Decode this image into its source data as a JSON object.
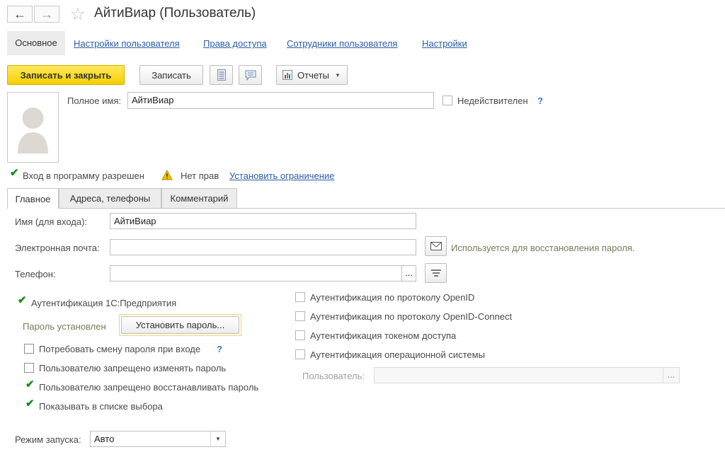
{
  "window": {
    "title": "АйтиВиар (Пользователь)"
  },
  "nav": {
    "back_icon": "arrow-left-icon",
    "forward_icon": "arrow-right-icon",
    "favorite_icon": "star-icon"
  },
  "top_tabs": [
    {
      "label": "Основное"
    },
    {
      "label": "Настройки пользователя"
    },
    {
      "label": "Права доступа"
    },
    {
      "label": "Сотрудники пользователя"
    },
    {
      "label": "Настройки"
    }
  ],
  "toolbar": {
    "save_close": "Записать и закрыть",
    "save": "Записать",
    "reports": "Отчеты"
  },
  "header": {
    "full_name_label": "Полное имя:",
    "full_name_value": "АйтиВиар",
    "invalid_label": "Недействителен",
    "help": "?"
  },
  "access": {
    "login_allowed": "Вход в программу разрешен",
    "no_rights": "Нет прав",
    "set_restriction": "Установить ограничение"
  },
  "inner_tabs": [
    {
      "label": "Главное"
    },
    {
      "label": "Адреса, телефоны"
    },
    {
      "label": "Комментарий"
    }
  ],
  "main": {
    "login_label": "Имя (для входа):",
    "login_value": "АйтиВиар",
    "email_label": "Электронная почта:",
    "email_value": "",
    "email_hint": "Используется для восстановления пароля.",
    "phone_label": "Телефон:",
    "phone_value": "",
    "dots": "...",
    "auth_1c": "Аутентификация 1С:Предприятия",
    "password_set": "Пароль установлен",
    "set_password": "Установить пароль...",
    "require_change": "Потребовать смену пароля при входе",
    "help": "?",
    "forbid_change": "Пользователю запрещено изменять пароль",
    "forbid_restore": "Пользователю запрещено восстанавливать пароль",
    "show_in_list": "Показывать в списке выбора",
    "auth_openid": "Аутентификация по протоколу OpenID",
    "auth_openid_connect": "Аутентификация по протоколу OpenID-Connect",
    "auth_token": "Аутентификация токеном доступа",
    "auth_os": "Аутентификация операционной системы",
    "os_user_label": "Пользователь:",
    "os_user_value": "",
    "launch_mode_label": "Режим запуска:",
    "launch_mode_value": "Авто"
  },
  "colors": {
    "primary_button": "#f5cf00",
    "link": "#2d5da8",
    "check": "#1a8a1a"
  }
}
